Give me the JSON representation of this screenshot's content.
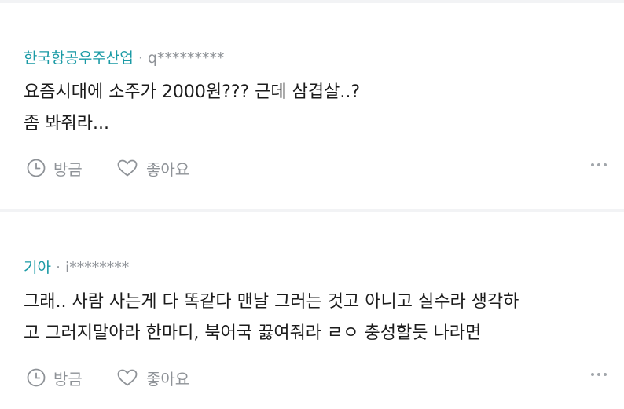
{
  "comments": [
    {
      "company": "한국항공우주산업",
      "separator": "·",
      "user": "q*********",
      "lines": [
        "요즘시대에 소주가 2000원??? 근데 삼겹살..?",
        "좀 봐줘라..."
      ],
      "reply_label": "방금",
      "like_label": "좋아요"
    },
    {
      "company": "기아",
      "separator": "·",
      "user": "i********",
      "lines": [
        "그래.. 사람 사는게 다 똑같다 맨날 그러는 것고 아니고 실수라 생각하",
        "고 그러지말아라 한마디, 북어국 끓여줘라 ㄹㅇ 충성할듯 나라면"
      ],
      "reply_label": "방금",
      "like_label": "좋아요"
    }
  ],
  "icons": {
    "time": "clock-icon",
    "like": "heart-icon",
    "more": "more-dots-icon"
  },
  "colors": {
    "company": "#1a9aa5",
    "text": "#1b1b1b",
    "muted": "#8e9297",
    "divider": "#f2f3f5"
  }
}
